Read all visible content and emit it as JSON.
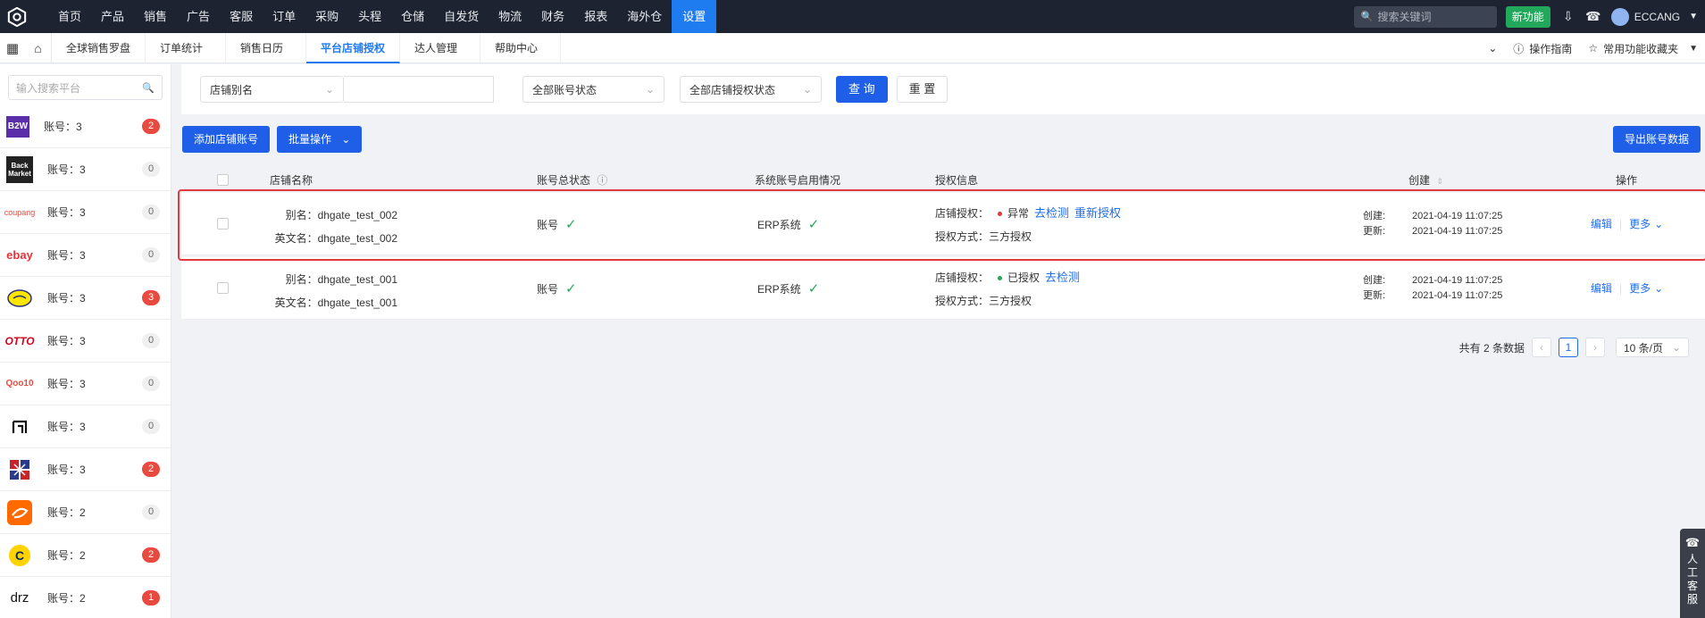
{
  "topnav": {
    "items": [
      "首页",
      "产品",
      "销售",
      "广告",
      "客服",
      "订单",
      "采购",
      "头程",
      "仓储",
      "自发货",
      "物流",
      "财务",
      "报表",
      "海外仓",
      "设置"
    ],
    "active_index": 14,
    "search_placeholder": "搜索关键词",
    "new_feature": "新功能",
    "username": "ECCANG"
  },
  "subnav": {
    "tabs": [
      "全球销售罗盘",
      "订单统计",
      "销售日历",
      "平台店铺授权",
      "达人管理",
      "帮助中心"
    ],
    "active_index": 3,
    "guide": "操作指南",
    "favorites": "常用功能收藏夹"
  },
  "sidebar": {
    "search_placeholder": "输入搜索平台",
    "items": [
      {
        "logo": "B2W",
        "count": "账号：3",
        "badge": "2",
        "badge_color": "#e84a3f"
      },
      {
        "logo": "Back Market",
        "count": "账号：3",
        "badge": "0",
        "badge_color": "#f0f0f0"
      },
      {
        "logo": "coupang",
        "count": "账号：3",
        "badge": "0",
        "badge_color": "#f0f0f0"
      },
      {
        "logo": "ebay",
        "count": "账号：3",
        "badge": "0",
        "badge_color": "#f0f0f0"
      },
      {
        "logo": "mercado-logo",
        "count": "账号：3",
        "badge": "3",
        "badge_color": "#e84a3f"
      },
      {
        "logo": "OTTO",
        "count": "账号：3",
        "badge": "0",
        "badge_color": "#f0f0f0"
      },
      {
        "logo": "Qoo10",
        "count": "账号：3",
        "badge": "0",
        "badge_color": "#f0f0f0"
      },
      {
        "logo": "bracket-logo",
        "count": "账号：3",
        "badge": "0",
        "badge_color": "#f0f0f0"
      },
      {
        "logo": "grid-logo",
        "count": "账号：3",
        "badge": "2",
        "badge_color": "#e84a3f"
      },
      {
        "logo": "alibaba-logo",
        "count": "账号：2",
        "badge": "0",
        "badge_color": "#f0f0f0"
      },
      {
        "logo": "cdiscount-logo",
        "count": "账号：2",
        "badge": "2",
        "badge_color": "#e84a3f"
      },
      {
        "logo": "drz",
        "count": "账号：2",
        "badge": "1",
        "badge_color": "#e84a3f"
      }
    ]
  },
  "filter": {
    "alias_select": "店铺别名",
    "alias_input": "",
    "account_status": "全部账号状态",
    "auth_status": "全部店铺授权状态",
    "query": "查 询",
    "reset": "重 置"
  },
  "actions": {
    "add_account": "添加店铺账号",
    "batch": "批量操作",
    "export": "导出账号数据"
  },
  "table": {
    "headers": {
      "name": "店铺名称",
      "status": "账号总状态",
      "system": "系统账号启用情况",
      "auth": "授权信息",
      "created": "创建",
      "ops": "操作"
    },
    "rows": [
      {
        "alias_label": "别名：",
        "alias": "dhgate_test_002",
        "en_label": "英文名：",
        "en": "dhgate_test_002",
        "account_label": "账号",
        "erp_label": "ERP系统",
        "auth_label": "店铺授权：",
        "auth_status": "异常",
        "auth_color": "#e0393e",
        "link1": "去检测",
        "link2": "重新授权",
        "method_label": "授权方式：",
        "method": "三方授权",
        "created_label": "创建:",
        "created": "2021-04-19 11:07:25",
        "updated_label": "更新:",
        "updated": "2021-04-19 11:07:25",
        "edit": "编辑",
        "more": "更多"
      },
      {
        "alias_label": "别名：",
        "alias": "dhgate_test_001",
        "en_label": "英文名：",
        "en": "dhgate_test_001",
        "account_label": "账号",
        "erp_label": "ERP系统",
        "auth_label": "店铺授权：",
        "auth_status": "已授权",
        "auth_color": "#22a85a",
        "link1": "去检测",
        "link2": "",
        "method_label": "授权方式：",
        "method": "三方授权",
        "created_label": "创建:",
        "created": "2021-04-19 11:07:25",
        "updated_label": "更新:",
        "updated": "2021-04-19 11:07:25",
        "edit": "编辑",
        "more": "更多"
      }
    ]
  },
  "pagination": {
    "total": "共有 2 条数据",
    "current": "1",
    "page_size": "10 条/页"
  },
  "support": "人工客服"
}
